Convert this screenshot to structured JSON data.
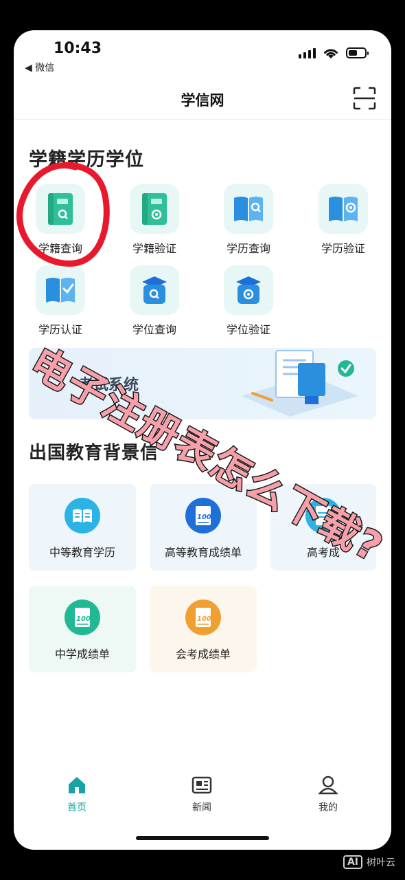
{
  "status_bar": {
    "time": "10:43",
    "back_app": "◀ 微信",
    "battery_level": 0.55
  },
  "nav": {
    "title": "学信网",
    "scan_icon": "scan-icon"
  },
  "section1": {
    "title": "学籍学历学位",
    "items": [
      {
        "label": "学籍查询",
        "icon": "book-search-icon"
      },
      {
        "label": "学籍验证",
        "icon": "book-verify-icon"
      },
      {
        "label": "学历查询",
        "icon": "diploma-search-icon"
      },
      {
        "label": "学历验证",
        "icon": "diploma-verify-icon"
      },
      {
        "label": "学历认证",
        "icon": "diploma-certify-icon"
      },
      {
        "label": "学位查询",
        "icon": "cap-search-icon"
      },
      {
        "label": "学位验证",
        "icon": "cap-verify-icon"
      }
    ]
  },
  "banner": {
    "text": "考试系统"
  },
  "section2": {
    "title": "出国教育背景信",
    "cards": [
      {
        "label": "中等教育学历",
        "icon": "open-book-icon",
        "color": "#2bb3e6",
        "bg": "#eef6fb"
      },
      {
        "label": "高等教育成绩单",
        "icon": "score-100-icon",
        "color": "#1f6fd8",
        "bg": "#eef6fb"
      },
      {
        "label": "高考成",
        "icon": "score-icon",
        "color": "#2bb3e6",
        "bg": "#eef6fb"
      },
      {
        "label": "中学成绩单",
        "icon": "score-100-icon",
        "color": "#21b894",
        "bg": "#eef8f5"
      },
      {
        "label": "会考成绩单",
        "icon": "score-100-icon",
        "color": "#f0a032",
        "bg": "#fdf6ec"
      }
    ]
  },
  "tabbar": {
    "tabs": [
      {
        "label": "首页",
        "icon": "home-icon",
        "active": true
      },
      {
        "label": "新闻",
        "icon": "news-icon",
        "active": false
      },
      {
        "label": "我的",
        "icon": "profile-icon",
        "active": false
      }
    ]
  },
  "overlay": {
    "caption": "电子注册表怎么下载?",
    "highlight_color": "#e8192c"
  },
  "watermark": {
    "logo": "AI",
    "text": "树叶云"
  },
  "colors": {
    "accent": "#17a2a3",
    "icon_teal": "#2fc09a",
    "icon_blue": "#2b8fe0"
  }
}
